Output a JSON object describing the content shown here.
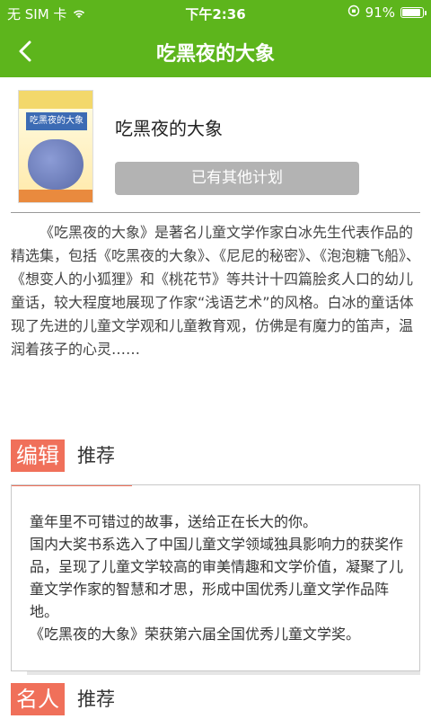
{
  "status_bar": {
    "carrier": "无 SIM 卡",
    "time": "下午2:36",
    "battery_text": "91%",
    "battery_level": 0.91
  },
  "nav": {
    "title": "吃黑夜的大象",
    "back_icon": "chevron-left-icon"
  },
  "book": {
    "cover_title": "吃黑夜的大象",
    "name": "吃黑夜的大象",
    "plan_button": "已有其他计划"
  },
  "intro": "《吃黑夜的大象》是著名儿童文学作家白冰先生代表作品的精选集，包括《吃黑夜的大象》、《尼尼的秘密》、《泡泡糖飞船》、《想变人的小狐狸》和《桃花节》等共计十四篇脍炙人口的幼儿童话，较大程度地展现了作家“浅语艺术”的风格。白冰的童话体现了先进的儿童文学观和儿童教育观，仿佛是有魔力的笛声，温润着孩子的心灵……",
  "editor_section": {
    "tag": "编辑",
    "label": "推荐",
    "lines": [
      "童年里不可错过的故事，送给正在长大的你。",
      "国内大奖书系选入了中国儿童文学领域独具影响力的获奖作品，呈现了儿童文学较高的审美情趣和文学价值，凝聚了儿童文学作家的智慧和才思，形成中国优秀儿童文学作品阵地。",
      "《吃黑夜的大象》荣获第六届全国优秀儿童文学奖。"
    ]
  },
  "celebrity_section": {
    "tag": "名人",
    "label": "推荐"
  },
  "colors": {
    "header_green": "#5db51c",
    "accent_red": "#f0705a",
    "button_gray": "#b3b3b3"
  }
}
